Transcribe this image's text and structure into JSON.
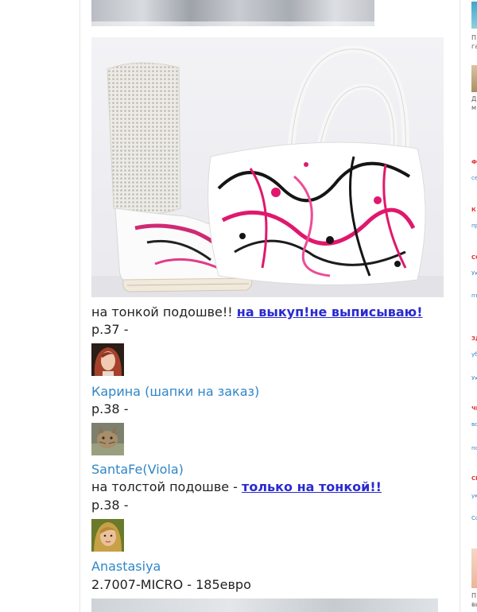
{
  "posts": [
    {
      "text": "на тонкой подошве!!",
      "link": "на выкуп!не выписываю!",
      "size": "р.37 -"
    },
    {
      "user": "Карина (шапки на заказ)",
      "size": "р.38 -"
    },
    {
      "user": "SantaFe(Viola)",
      "text": "на толстой подошве -",
      "link": "только на тонкой!!",
      "size": "р.38 -"
    },
    {
      "user": "Anastasiya",
      "text": "2.7007-MICRO - 185евро"
    }
  ],
  "sidebar": {
    "snippets": [
      "П",
      "га",
      "Д",
      "м",
      "П",
      "вь"
    ],
    "categories": [
      "Ф",
      "К",
      "СС",
      "ЗД",
      "ЧІ",
      "СІ"
    ],
    "links": [
      "се",
      "пр",
      "Ук",
      "пъ",
      "уб",
      "Ук",
      "во",
      "по",
      "ук",
      "Сс"
    ]
  },
  "colors": {
    "link_user": "#2f86c8",
    "link_buy": "#2a2ad0",
    "sidebar_category": "#dd3333"
  }
}
